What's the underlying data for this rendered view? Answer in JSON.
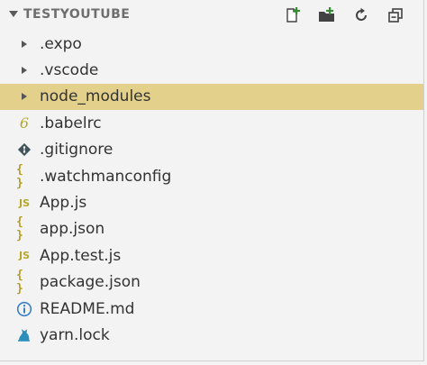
{
  "explorer": {
    "title": "TESTYOUTUBE",
    "actions": [
      {
        "name": "new-file-icon"
      },
      {
        "name": "new-folder-icon"
      },
      {
        "name": "refresh-icon"
      },
      {
        "name": "collapse-all-icon"
      }
    ]
  },
  "tree": {
    "items": [
      {
        "label": ".expo",
        "icon": "chevron-right-icon",
        "type": "folder"
      },
      {
        "label": ".vscode",
        "icon": "chevron-right-icon",
        "type": "folder"
      },
      {
        "label": "node_modules",
        "icon": "chevron-right-icon",
        "type": "folder",
        "selected": true
      },
      {
        "label": ".babelrc",
        "icon": "babel-icon",
        "type": "file"
      },
      {
        "label": ".gitignore",
        "icon": "git-icon",
        "type": "file"
      },
      {
        "label": ".watchmanconfig",
        "icon": "json-braces-icon",
        "type": "file"
      },
      {
        "label": "App.js",
        "icon": "javascript-icon",
        "type": "file"
      },
      {
        "label": "app.json",
        "icon": "json-braces-icon",
        "type": "file"
      },
      {
        "label": "App.test.js",
        "icon": "javascript-icon",
        "type": "file"
      },
      {
        "label": "package.json",
        "icon": "json-braces-icon",
        "type": "file"
      },
      {
        "label": "README.md",
        "icon": "info-icon",
        "type": "file"
      },
      {
        "label": "yarn.lock",
        "icon": "yarn-cat-icon",
        "type": "file"
      }
    ]
  },
  "colors": {
    "selection": "#e3d08b",
    "icon_accent": "#b5a72b",
    "info_blue": "#3b7fc4",
    "yarn_blue": "#2c8ebb"
  },
  "icon_text": {
    "json": "{ }",
    "js": "JS",
    "babel": "6"
  }
}
